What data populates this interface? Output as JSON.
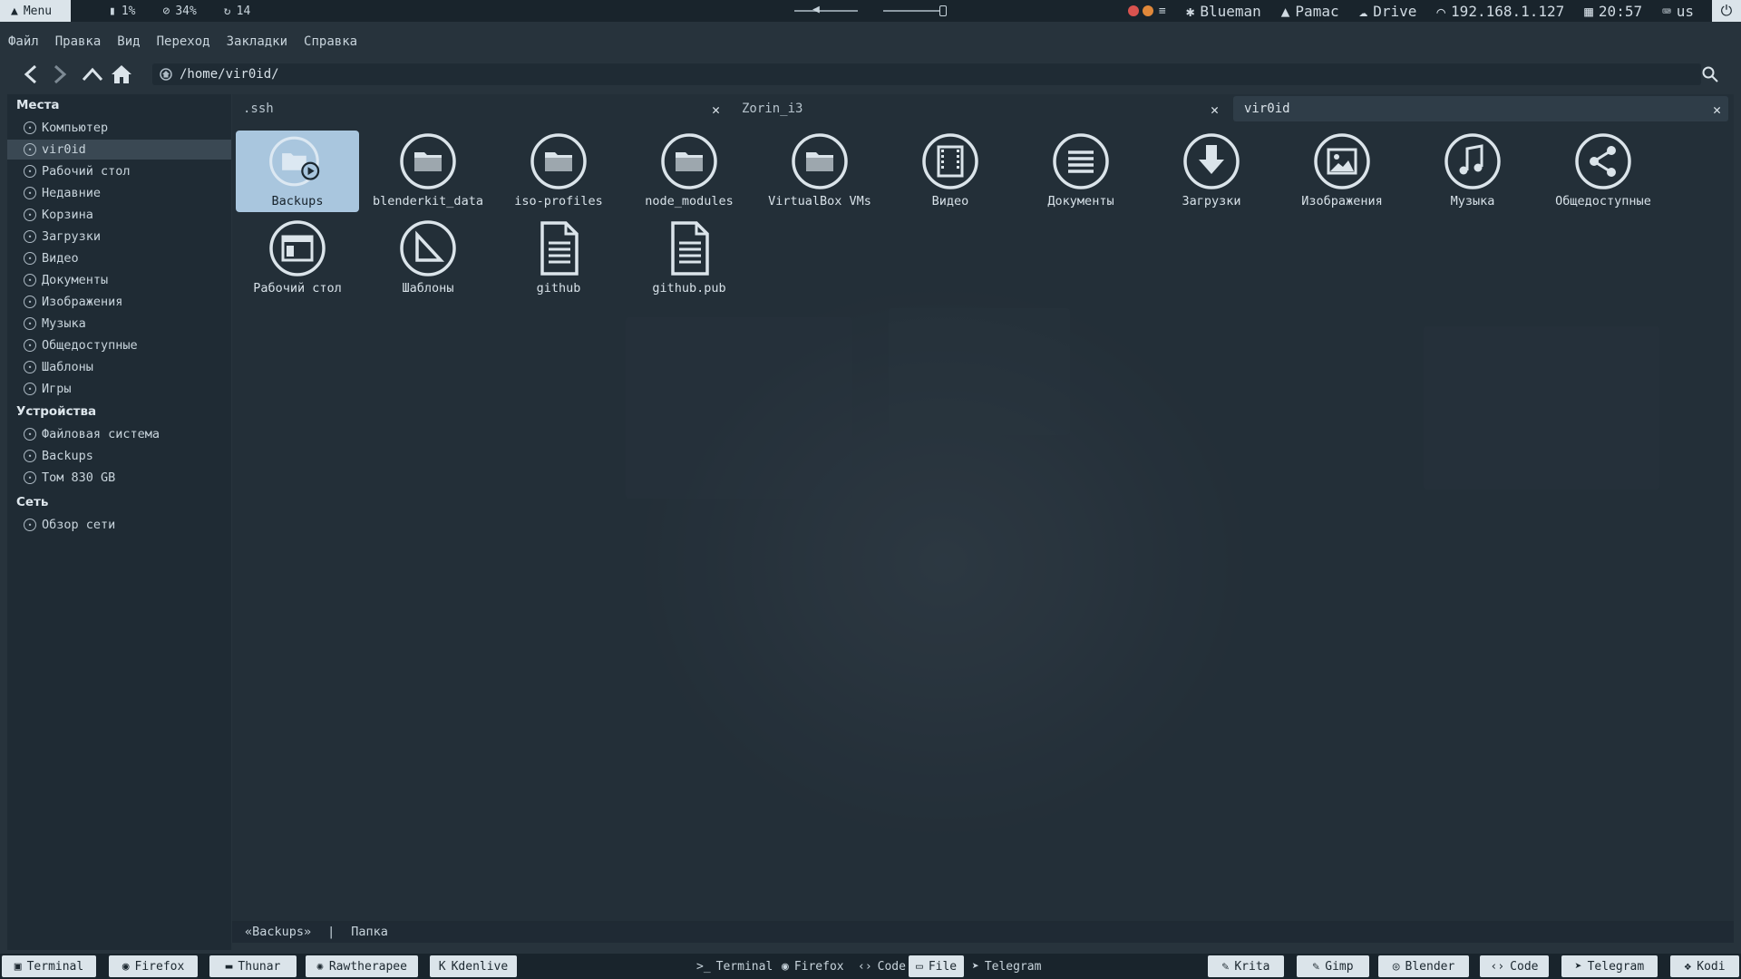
{
  "top_panel": {
    "menu_label": "Menu",
    "cpu": "1%",
    "disk": "34%",
    "updates": "14",
    "blueman": "Blueman",
    "pamac": "Pamac",
    "drive": "Drive",
    "ip": "192.168.1.127",
    "clock": "20:57",
    "keyboard": "us"
  },
  "menubar": [
    "Файл",
    "Правка",
    "Вид",
    "Переход",
    "Закладки",
    "Справка"
  ],
  "location": "/home/vir0id/",
  "sidebar": {
    "places_header": "Места",
    "places": [
      {
        "label": "Компьютер",
        "icon": "computer-icon"
      },
      {
        "label": "vir0id",
        "icon": "home-icon",
        "active": true
      },
      {
        "label": "Рабочий стол",
        "icon": "desktop-icon"
      },
      {
        "label": "Недавние",
        "icon": "recent-icon"
      },
      {
        "label": "Корзина",
        "icon": "trash-icon"
      },
      {
        "label": "Загрузки",
        "icon": "downloads-icon"
      },
      {
        "label": "Видео",
        "icon": "video-icon"
      },
      {
        "label": "Документы",
        "icon": "documents-icon"
      },
      {
        "label": "Изображения",
        "icon": "pictures-icon"
      },
      {
        "label": "Музыка",
        "icon": "music-icon"
      },
      {
        "label": "Общедоступные",
        "icon": "share-icon"
      },
      {
        "label": "Шаблоны",
        "icon": "templates-icon"
      },
      {
        "label": "Игры",
        "icon": "games-icon"
      }
    ],
    "devices_header": "Устройства",
    "devices": [
      {
        "label": "Файловая система",
        "icon": "drive-icon"
      },
      {
        "label": "Backups",
        "icon": "drive-icon"
      },
      {
        "label": "Том 830 GB",
        "icon": "drive-icon"
      }
    ],
    "network_header": "Сеть",
    "network": [
      {
        "label": "Обзор сети",
        "icon": "network-icon"
      }
    ]
  },
  "tabs": [
    {
      "label": ".ssh"
    },
    {
      "label": "Zorin_i3"
    },
    {
      "label": "vir0id",
      "active": true
    }
  ],
  "files": [
    {
      "name": "Backups",
      "icon": "folder-backup-icon",
      "selected": true
    },
    {
      "name": "blenderkit_data",
      "icon": "folder-icon"
    },
    {
      "name": "iso-profiles",
      "icon": "folder-icon"
    },
    {
      "name": "node_modules",
      "icon": "folder-icon"
    },
    {
      "name": "VirtualBox VMs",
      "icon": "folder-icon"
    },
    {
      "name": "Видео",
      "icon": "video-folder-icon"
    },
    {
      "name": "Документы",
      "icon": "documents-folder-icon"
    },
    {
      "name": "Загрузки",
      "icon": "downloads-folder-icon"
    },
    {
      "name": "Изображения",
      "icon": "pictures-folder-icon"
    },
    {
      "name": "Музыка",
      "icon": "music-folder-icon"
    },
    {
      "name": "Общедоступные",
      "icon": "share-folder-icon"
    },
    {
      "name": "Рабочий стол",
      "icon": "desktop-folder-icon"
    },
    {
      "name": "Шаблоны",
      "icon": "templates-folder-icon"
    },
    {
      "name": "github",
      "icon": "text-file-icon"
    },
    {
      "name": "github.pub",
      "icon": "text-file-icon"
    }
  ],
  "status": {
    "name": "«Backups»",
    "separator": "|",
    "type": "Папка"
  },
  "taskbar": {
    "left": [
      "Terminal",
      "Firefox",
      "Thunar",
      "Rawtherapee",
      "Kdenlive"
    ],
    "middle": [
      "Terminal",
      "Firefox",
      "Code",
      "File",
      "Telegram"
    ],
    "middle_active": "File",
    "right": [
      "Krita",
      "Gimp",
      "Blender",
      "Code",
      "Telegram",
      "Kodi"
    ]
  },
  "colors": {
    "accent_selected": "#a9c6de",
    "panel_bg": "#19242c",
    "window_bg": "#27333c",
    "text": "#d0dae2"
  }
}
